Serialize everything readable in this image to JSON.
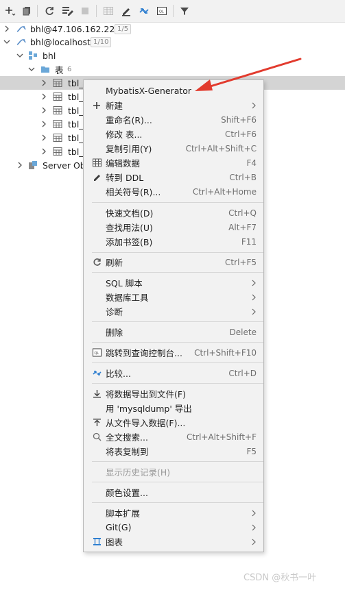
{
  "toolbar": {
    "icons": [
      "add-icon",
      "copy-icon",
      "refresh-icon",
      "properties-icon",
      "stop-icon",
      "table-icon",
      "edit-icon",
      "compare-icon",
      "sql-console-icon",
      "filter-icon"
    ]
  },
  "tree": {
    "rows": [
      {
        "label": "bhl@47.106.162.222",
        "count": "1/5"
      },
      {
        "label": "bhl@localhost",
        "count": "1/10"
      },
      {
        "label": "bhl"
      },
      {
        "label": "表",
        "count": "6"
      },
      {
        "label": "tbl_"
      },
      {
        "label": "tbl_("
      },
      {
        "label": "tbl_i"
      },
      {
        "label": "tbl_("
      },
      {
        "label": "tbl_("
      },
      {
        "label": "tbl_("
      },
      {
        "label": "Server Ob"
      }
    ]
  },
  "menu": {
    "items": [
      {
        "label": "MybatisX-Generator",
        "shortcut": ""
      },
      {
        "label": "新建",
        "shortcut": ""
      },
      {
        "label": "重命名(R)...",
        "shortcut": "Shift+F6"
      },
      {
        "label": "修改 表...",
        "shortcut": "Ctrl+F6"
      },
      {
        "label": "复制引用(Y)",
        "shortcut": "Ctrl+Alt+Shift+C"
      },
      {
        "label": "编辑数据",
        "shortcut": "F4"
      },
      {
        "label": "转到 DDL",
        "shortcut": "Ctrl+B"
      },
      {
        "label": "相关符号(R)...",
        "shortcut": "Ctrl+Alt+Home"
      },
      {
        "label": "快速文档(D)",
        "shortcut": "Ctrl+Q"
      },
      {
        "label": "查找用法(U)",
        "shortcut": "Alt+F7"
      },
      {
        "label": "添加书签(B)",
        "shortcut": "F11"
      },
      {
        "label": "刷新",
        "shortcut": "Ctrl+F5"
      },
      {
        "label": "SQL 脚本",
        "shortcut": ""
      },
      {
        "label": "数据库工具",
        "shortcut": ""
      },
      {
        "label": "诊断",
        "shortcut": ""
      },
      {
        "label": "删除",
        "shortcut": "Delete"
      },
      {
        "label": "跳转到查询控制台...",
        "shortcut": "Ctrl+Shift+F10"
      },
      {
        "label": "比较...",
        "shortcut": "Ctrl+D"
      },
      {
        "label": "将数据导出到文件(F)",
        "shortcut": ""
      },
      {
        "label": "用 'mysqldump' 导出",
        "shortcut": ""
      },
      {
        "label": "从文件导入数据(F)...",
        "shortcut": ""
      },
      {
        "label": "全文搜索...",
        "shortcut": "Ctrl+Alt+Shift+F"
      },
      {
        "label": "将表复制到",
        "shortcut": "F5"
      },
      {
        "label": "显示历史记录(H)",
        "shortcut": ""
      },
      {
        "label": "颜色设置...",
        "shortcut": ""
      },
      {
        "label": "脚本扩展",
        "shortcut": ""
      },
      {
        "label": "Git(G)",
        "shortcut": ""
      },
      {
        "label": "图表",
        "shortcut": ""
      }
    ]
  },
  "watermark": "CSDN @秋书一叶",
  "colors": {
    "annotation_arrow": "#e23b2e",
    "selection": "#d4d4d4",
    "menu_bg": "#f2f2f2",
    "folder": "#6aa7d8"
  }
}
